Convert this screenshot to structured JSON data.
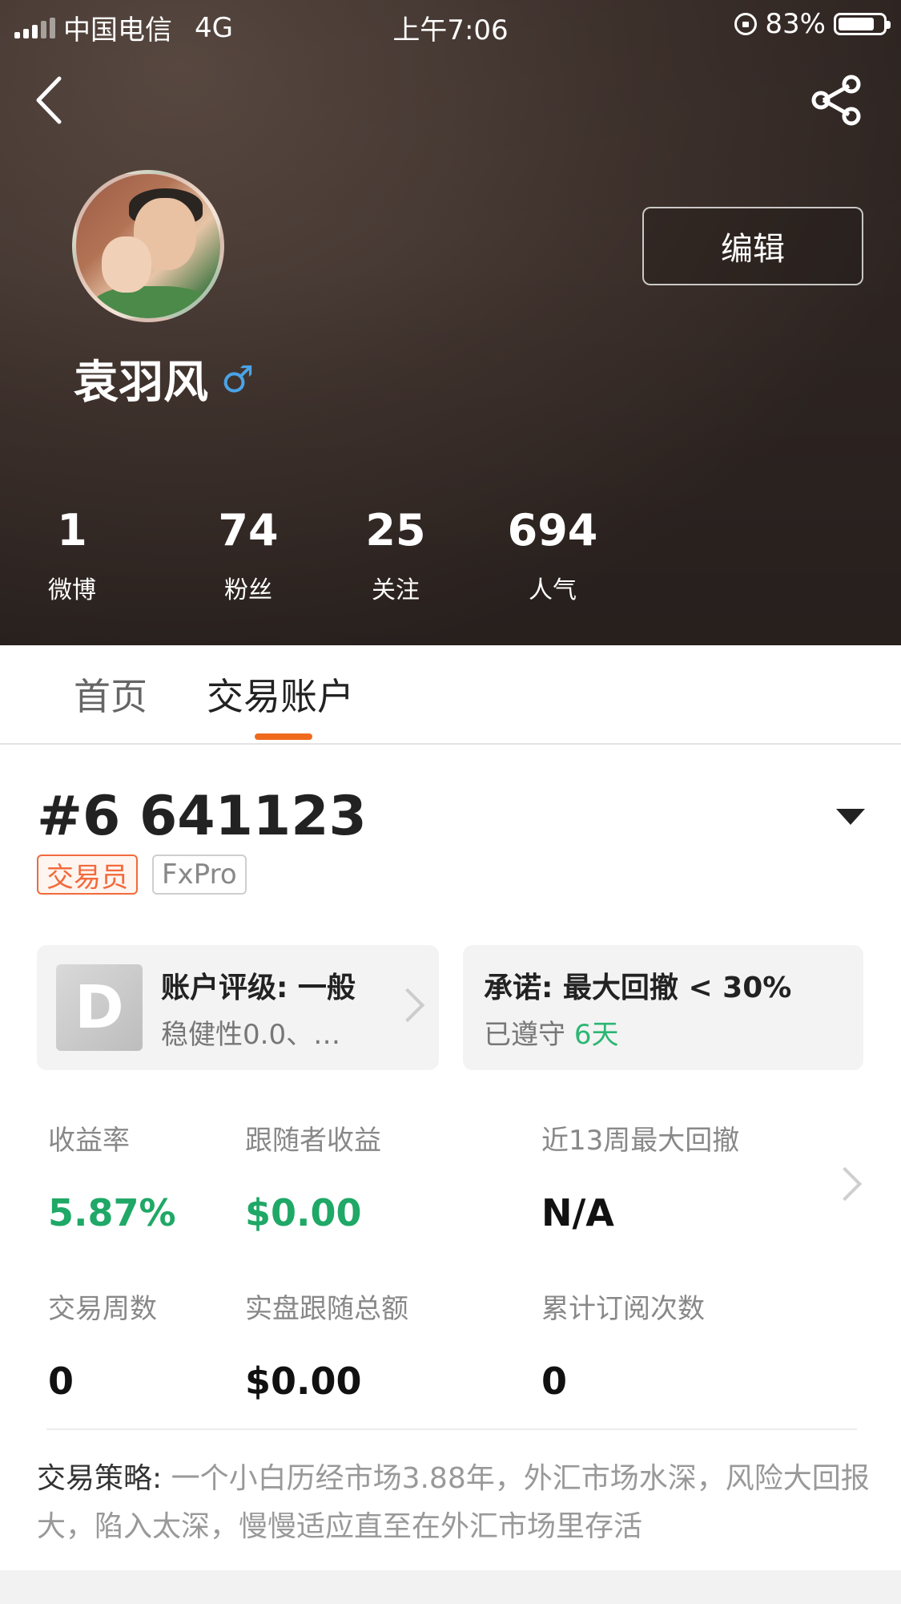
{
  "status_bar": {
    "carrier": "中国电信",
    "network": "4G",
    "time": "上午7:06",
    "battery": "83%"
  },
  "header": {
    "edit_label": "编辑",
    "username": "袁羽风",
    "gender_symbol": "♂"
  },
  "stats": [
    {
      "value": "1",
      "label": "微博"
    },
    {
      "value": "74",
      "label": "粉丝"
    },
    {
      "value": "25",
      "label": "关注"
    },
    {
      "value": "694",
      "label": "人气"
    }
  ],
  "tabs": {
    "home": "首页",
    "account": "交易账户",
    "active": "account"
  },
  "account": {
    "id": "#6 641123",
    "tags": {
      "role": "交易员",
      "broker": "FxPro"
    }
  },
  "cards": {
    "rating": {
      "grade": "D",
      "title": "账户评级: 一般",
      "subtitle": "稳健性0.0、…"
    },
    "promise": {
      "title": "承诺: 最大回撤 < 30%",
      "status_prefix": "已遵守",
      "days": "6天"
    }
  },
  "metrics": {
    "return_rate": {
      "label": "收益率",
      "value": "5.87%"
    },
    "follower_profit": {
      "label": "跟随者收益",
      "value": "$0.00"
    },
    "max_drawdown": {
      "label": "近13周最大回撤",
      "value": "N/A"
    },
    "trade_weeks": {
      "label": "交易周数",
      "value": "0"
    },
    "real_follow_total": {
      "label": "实盘跟随总额",
      "value": "$0.00"
    },
    "subscriptions": {
      "label": "累计订阅次数",
      "value": "0"
    }
  },
  "strategy": {
    "label": "交易策略: ",
    "text": "一个小白历经市场3.88年，外汇市场水深，风险大回报大，陷入太深，慢慢适应直至在外汇市场里存活"
  },
  "colors": {
    "accent_orange": "#f06a1e",
    "positive_green": "#1fa866",
    "gender_blue": "#4aa3e6"
  }
}
